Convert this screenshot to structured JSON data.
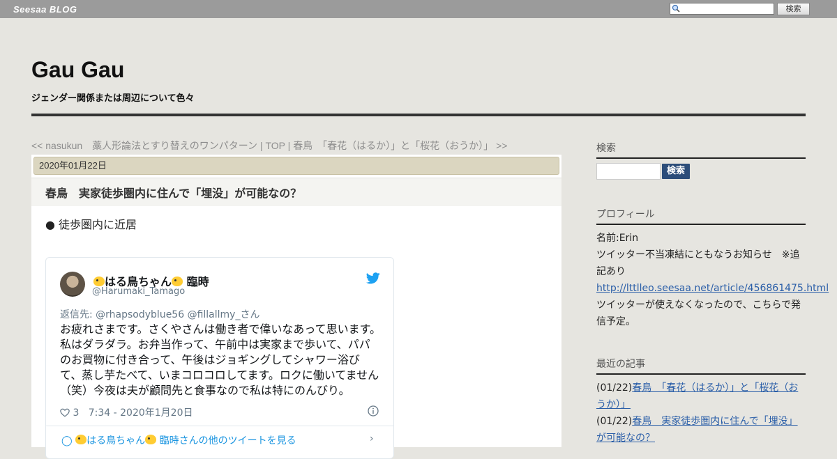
{
  "topbar": {
    "brand": "Seesaa BLOG",
    "search_button": "検索"
  },
  "header": {
    "title": "Gau Gau",
    "description": "ジェンダー関係または周辺について色々"
  },
  "nav": {
    "prev": "<< nasukun　藁人形論法とすり替えのワンパターン",
    "sep1": " | ",
    "top": "TOP",
    "sep2": " | ",
    "next": "春鳥　「春花（はるか）」と「桜花（おうか）」 >>"
  },
  "post": {
    "date": "2020年01月22日",
    "title": "春鳥　実家徒歩圏内に住んで「埋没」が可能なの？",
    "bullet": "● 徒歩圏内に近居"
  },
  "tweet": {
    "name_part1": "はる鳥ちゃん",
    "name_part2": " 臨時",
    "handle": "@Harumaki_Tamago",
    "reply_to": "返信先: @rhapsodyblue56 @fillallmy_さん",
    "text": "お疲れさまです。さくやさんは働き者で偉いなあって思います。私はダラダラ。お弁当作って、午前中は実家まで歩いて、パパのお買物に付き合って、午後はジョギングしてシャワー浴びて、蒸し芋たべて、いまコロコロしてます。ロクに働いてません（笑）今夜は夫が顧問先と食事なので私は特にのんびり。",
    "likes": "3",
    "timestamp": "7:34 - 2020年1月20日",
    "more_part1": "はる鳥ちゃん",
    "more_part2": " 臨時さんの他のツイートを見る"
  },
  "sidebar": {
    "search_heading": "検索",
    "search_button": "検索",
    "profile_heading": "プロフィール",
    "profile_name": "名前:Erin",
    "profile_note": "ツイッター不当凍結にともなうお知らせ　※追記あり",
    "profile_link": "http://lttlleo.seesaa.net/article/456861475.html",
    "profile_note2": "ツイッターが使えなくなったので、こちらで発信予定。",
    "recent_heading": "最近の記事",
    "recent": [
      {
        "date": "(01/22)",
        "title": "春鳥　「春花（はるか）」と「桜花（おうか）」"
      },
      {
        "date": "(01/22)",
        "title": "春鳥　実家徒歩圏内に住んで「埋没」が可能なの？"
      }
    ]
  },
  "colors": {
    "topbar": "#9b9b9b",
    "page_bg": "#e6e5e0",
    "date_bar": "#dbd6c0",
    "link": "#2a5ea8",
    "button": "#2c4d7a"
  }
}
